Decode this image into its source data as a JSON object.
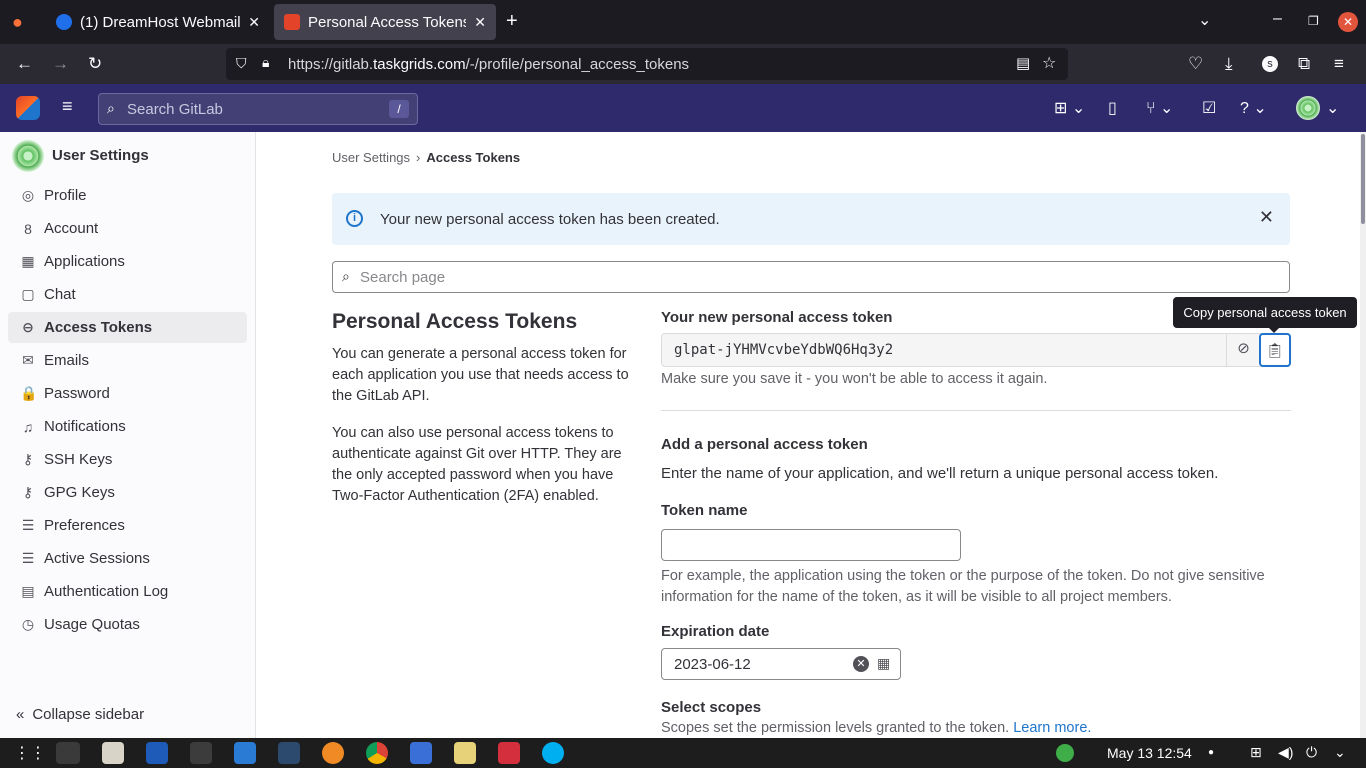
{
  "browser": {
    "tabs": [
      {
        "title": "(1) DreamHost Webmail :",
        "favicon_color": "#1f6feb"
      },
      {
        "title": "Personal Access Tokens ·",
        "favicon_color": "#e24329"
      }
    ],
    "new_tab_label": "+",
    "url_prefix": "https://gitlab.",
    "url_domain": "taskgrids.com",
    "url_path": "/-/profile/personal_access_tokens"
  },
  "gitlab_header": {
    "search_placeholder": "Search GitLab",
    "search_shortcut": "/"
  },
  "sidebar": {
    "title": "User Settings",
    "items": [
      {
        "label": "Profile",
        "icon": "user-circle-icon",
        "glyph": "◎"
      },
      {
        "label": "Account",
        "icon": "account-icon",
        "glyph": "8"
      },
      {
        "label": "Applications",
        "icon": "applications-icon",
        "glyph": "▦"
      },
      {
        "label": "Chat",
        "icon": "chat-icon",
        "glyph": "▢"
      },
      {
        "label": "Access Tokens",
        "icon": "token-icon",
        "glyph": "⊖"
      },
      {
        "label": "Emails",
        "icon": "mail-icon",
        "glyph": "✉"
      },
      {
        "label": "Password",
        "icon": "lock-icon",
        "glyph": "🔒"
      },
      {
        "label": "Notifications",
        "icon": "bell-icon",
        "glyph": "♫"
      },
      {
        "label": "SSH Keys",
        "icon": "key-icon",
        "glyph": "⚷"
      },
      {
        "label": "GPG Keys",
        "icon": "key-icon",
        "glyph": "⚷"
      },
      {
        "label": "Preferences",
        "icon": "preferences-icon",
        "glyph": "☰"
      },
      {
        "label": "Active Sessions",
        "icon": "sessions-icon",
        "glyph": "☰"
      },
      {
        "label": "Authentication Log",
        "icon": "log-icon",
        "glyph": "▤"
      },
      {
        "label": "Usage Quotas",
        "icon": "quota-icon",
        "glyph": "◷"
      }
    ],
    "active_index": 4,
    "collapse_label": "Collapse sidebar"
  },
  "breadcrumb": {
    "parent": "User Settings",
    "separator": "›",
    "current": "Access Tokens"
  },
  "alert": {
    "message": "Your new personal access token has been created.",
    "close_glyph": "✕"
  },
  "search_page": {
    "placeholder": "Search page"
  },
  "left_panel": {
    "title": "Personal Access Tokens",
    "para1": "You can generate a personal access token for each application you use that needs access to the GitLab API.",
    "para2": "You can also use personal access tokens to authenticate against Git over HTTP. They are the only accepted password when you have Two-Factor Authentication (2FA) enabled."
  },
  "new_token": {
    "label": "Your new personal access token",
    "value": "glpat-jYHMVcvbeYdbWQ6Hq3y2",
    "hint": "Make sure you save it - you won't be able to access it again.",
    "tooltip": "Copy personal access token"
  },
  "add_token": {
    "heading": "Add a personal access token",
    "description": "Enter the name of your application, and we'll return a unique personal access token.",
    "token_name_label": "Token name",
    "token_name_value": "",
    "token_name_hint": "For example, the application using the token or the purpose of the token. Do not give sensitive information for the name of the token, as it will be visible to all project members.",
    "expiration_label": "Expiration date",
    "expiration_value": "2023-06-12",
    "scopes_label": "Select scopes",
    "scopes_hint": "Scopes set the permission levels granted to the token.",
    "learn_more": "Learn more."
  },
  "taskbar": {
    "clock": "May 13  12:54"
  },
  "colors": {
    "gitlab_header": "#2f2a6b",
    "alert_bg": "#e9f3fc",
    "link": "#1f75cb"
  }
}
